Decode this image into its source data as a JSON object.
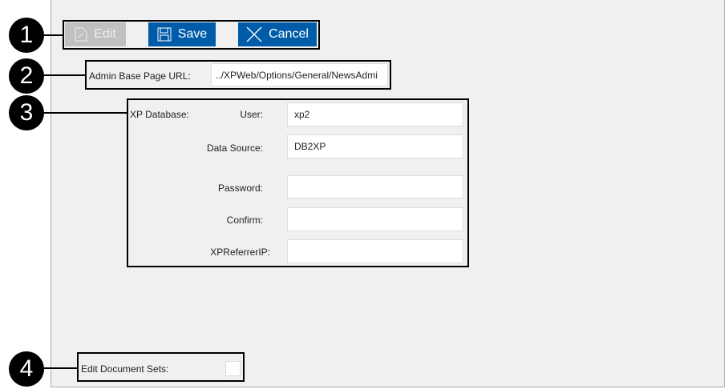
{
  "callouts": [
    "1",
    "2",
    "3",
    "4"
  ],
  "toolbar": {
    "edit_label": "Edit",
    "save_label": "Save",
    "cancel_label": "Cancel"
  },
  "admin_url": {
    "label": "Admin Base Page URL:",
    "value": "../XPWeb/Options/General/NewsAdmi"
  },
  "xp_database": {
    "label": "XP Database:",
    "fields": [
      {
        "label": "User:",
        "value": "xp2"
      },
      {
        "label": "Data Source:",
        "value": "DB2XP"
      },
      {
        "label": "Password:",
        "value": ""
      },
      {
        "label": "Confirm:",
        "value": ""
      },
      {
        "label": "XPReferrerIP:",
        "value": ""
      }
    ]
  },
  "edit_document_sets": {
    "label": "Edit Document Sets:",
    "checked": false
  },
  "colors": {
    "primary": "#005ca8",
    "disabled": "#c0c0c0",
    "panel": "#f0f0f0"
  }
}
